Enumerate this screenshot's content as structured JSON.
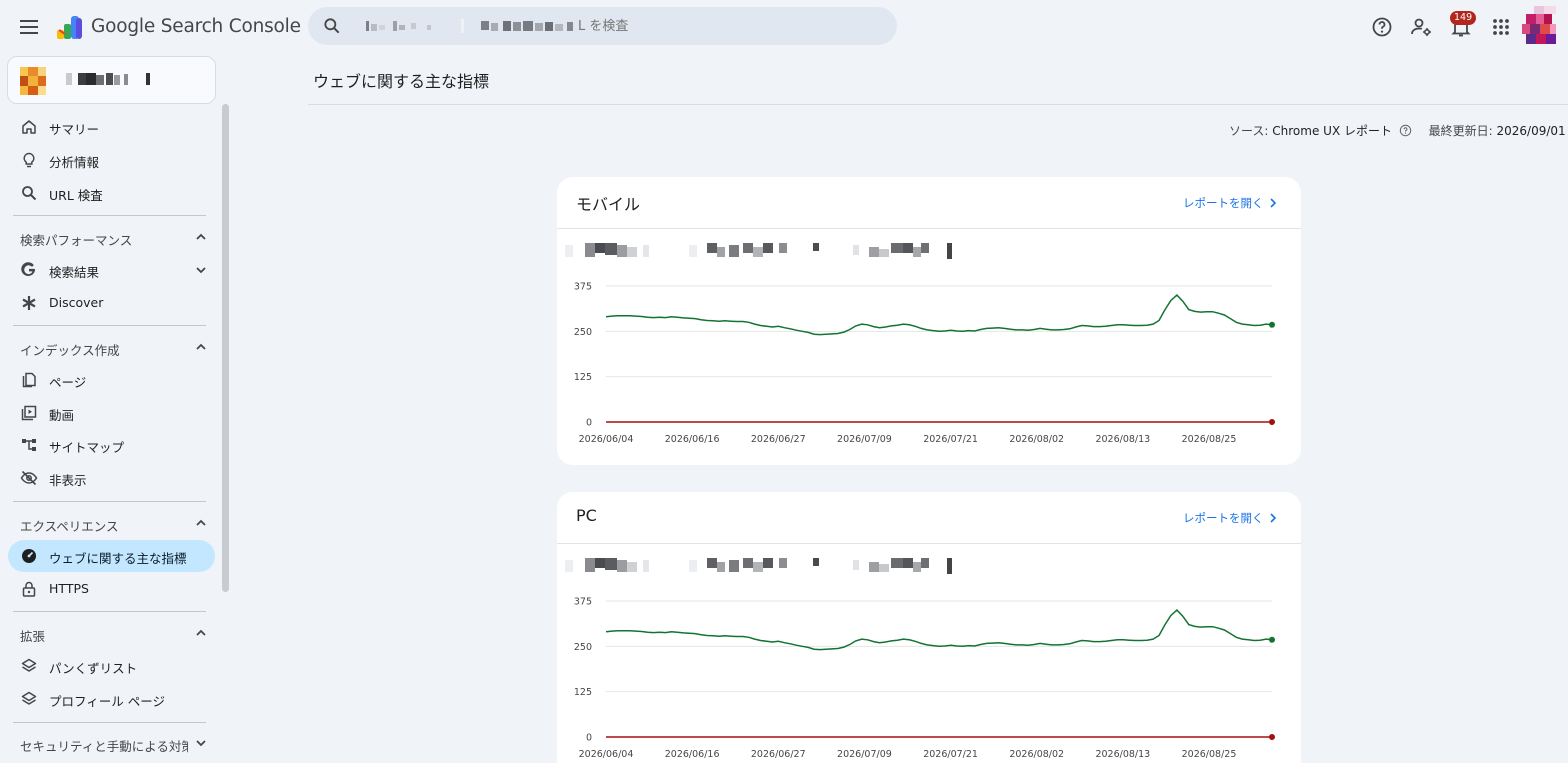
{
  "app": {
    "product_name": "Google Search Console",
    "search_placeholder": "L を検査",
    "notification_count": "149"
  },
  "colors": {
    "good_line": "#137333",
    "poor_line": "#a50e0e",
    "accent_link": "#1a73e8",
    "active_nav_bg": "#c2e7ff",
    "badge": "#b3261e"
  },
  "sidebar": {
    "top_items": [
      {
        "label": "サマリー",
        "icon": "home-icon"
      },
      {
        "label": "分析情報",
        "icon": "lightbulb-icon"
      },
      {
        "label": "URL 検査",
        "icon": "search-icon"
      }
    ],
    "sections": [
      {
        "label": "検索パフォーマンス",
        "expanded": true,
        "items": [
          {
            "label": "検索結果",
            "icon": "google-g-icon",
            "has_submenu": true
          },
          {
            "label": "Discover",
            "icon": "asterisk-icon"
          }
        ]
      },
      {
        "label": "インデックス作成",
        "expanded": true,
        "items": [
          {
            "label": "ページ",
            "icon": "pages-icon"
          },
          {
            "label": "動画",
            "icon": "video-icon"
          },
          {
            "label": "サイトマップ",
            "icon": "sitemap-icon"
          },
          {
            "label": "非表示",
            "icon": "eye-off-icon"
          }
        ]
      },
      {
        "label": "エクスペリエンス",
        "expanded": true,
        "items": [
          {
            "label": "ウェブに関する主な指標",
            "icon": "speedometer-icon",
            "active": true
          },
          {
            "label": "HTTPS",
            "icon": "lock-icon"
          }
        ]
      },
      {
        "label": "拡張",
        "expanded": true,
        "items": [
          {
            "label": "パンくずリスト",
            "icon": "layers-icon"
          },
          {
            "label": "プロフィール ページ",
            "icon": "layers-icon"
          }
        ]
      },
      {
        "label": "セキュリティと手動による対策",
        "expanded": false,
        "items": []
      }
    ]
  },
  "main": {
    "page_title": "ウェブに関する主な指標",
    "source_label": "ソース:",
    "source_value": "Chrome UX レポート",
    "updated_label": "最終更新日:",
    "updated_value": "2026/09/01",
    "cards": [
      {
        "title": "モバイル",
        "link": "レポートを開く"
      },
      {
        "title": "PC",
        "link": "レポートを開く"
      }
    ]
  },
  "chart_data": [
    {
      "type": "line",
      "title": "モバイル",
      "xlabel": "",
      "ylabel": "",
      "ylim": [
        0,
        375
      ],
      "yticks": [
        0,
        125,
        250,
        375
      ],
      "xtick_labels": [
        "2026/06/04",
        "2026/06/16",
        "2026/06/27",
        "2026/07/09",
        "2026/07/21",
        "2026/08/02",
        "2026/08/13",
        "2026/08/25"
      ],
      "grid": true,
      "series": [
        {
          "color": "#137333",
          "values": [
            290,
            292,
            293,
            293,
            293,
            292,
            291,
            289,
            288,
            289,
            288,
            290,
            289,
            287,
            286,
            285,
            282,
            280,
            279,
            278,
            279,
            278,
            277,
            277,
            275,
            270,
            266,
            264,
            262,
            264,
            260,
            257,
            253,
            250,
            247,
            242,
            241,
            242,
            243,
            244,
            248,
            255,
            265,
            270,
            268,
            263,
            260,
            262,
            265,
            267,
            270,
            268,
            264,
            258,
            254,
            252,
            250,
            251,
            253,
            251,
            250,
            252,
            251,
            255,
            258,
            259,
            260,
            258,
            256,
            254,
            254,
            253,
            255,
            258,
            256,
            254,
            254,
            255,
            257,
            262,
            266,
            265,
            263,
            263,
            264,
            266,
            268,
            268,
            267,
            266,
            266,
            267,
            270,
            280,
            310,
            335,
            350,
            333,
            310,
            305,
            303,
            304,
            304,
            300,
            295,
            285,
            275,
            270,
            268,
            266,
            267,
            270,
            268
          ]
        },
        {
          "color": "#a50e0e",
          "values": [
            0,
            0,
            0,
            0,
            0,
            0,
            0,
            0,
            0,
            0,
            0,
            0,
            0,
            0,
            0,
            0,
            0,
            0,
            0,
            0,
            0,
            0,
            0,
            0,
            0,
            0,
            0,
            0,
            0,
            0,
            0,
            0,
            0,
            0,
            0,
            0,
            0,
            0,
            0,
            0,
            0,
            0,
            0,
            0,
            0,
            0,
            0,
            0,
            0,
            0,
            0,
            0,
            0,
            0,
            0,
            0,
            0,
            0,
            0,
            0,
            0,
            0,
            0,
            0,
            0,
            0,
            0,
            0,
            0,
            0,
            0,
            0,
            0,
            0,
            0,
            0,
            0,
            0,
            0,
            0,
            0,
            0,
            0,
            0,
            0,
            0,
            0,
            0,
            0,
            0,
            0,
            0,
            0,
            0,
            0,
            0,
            0,
            0,
            0,
            0,
            0,
            0,
            0,
            0,
            0,
            0,
            0,
            0,
            0,
            0,
            0,
            0,
            0
          ]
        }
      ]
    },
    {
      "type": "line",
      "title": "PC",
      "xlabel": "",
      "ylabel": "",
      "ylim": [
        0,
        375
      ],
      "yticks": [
        0,
        125,
        250,
        375
      ],
      "xtick_labels": [
        "2026/06/04",
        "2026/06/16",
        "2026/06/27",
        "2026/07/09",
        "2026/07/21",
        "2026/08/02",
        "2026/08/13",
        "2026/08/25"
      ],
      "grid": true,
      "series": [
        {
          "color": "#137333",
          "values": [
            290,
            292,
            293,
            293,
            293,
            292,
            291,
            289,
            288,
            289,
            288,
            290,
            289,
            287,
            286,
            285,
            282,
            280,
            279,
            278,
            279,
            278,
            277,
            277,
            275,
            270,
            266,
            264,
            262,
            264,
            260,
            257,
            253,
            250,
            247,
            242,
            241,
            242,
            243,
            244,
            248,
            255,
            265,
            270,
            268,
            263,
            260,
            262,
            265,
            267,
            270,
            268,
            264,
            258,
            254,
            252,
            250,
            251,
            253,
            251,
            250,
            252,
            251,
            255,
            258,
            259,
            260,
            258,
            256,
            254,
            254,
            253,
            255,
            258,
            256,
            254,
            254,
            255,
            257,
            262,
            266,
            265,
            263,
            263,
            264,
            266,
            268,
            268,
            267,
            266,
            266,
            267,
            270,
            280,
            310,
            335,
            350,
            333,
            310,
            305,
            303,
            304,
            304,
            300,
            295,
            285,
            275,
            270,
            268,
            266,
            267,
            270,
            268
          ]
        },
        {
          "color": "#a50e0e",
          "values": [
            0,
            0,
            0,
            0,
            0,
            0,
            0,
            0,
            0,
            0,
            0,
            0,
            0,
            0,
            0,
            0,
            0,
            0,
            0,
            0,
            0,
            0,
            0,
            0,
            0,
            0,
            0,
            0,
            0,
            0,
            0,
            0,
            0,
            0,
            0,
            0,
            0,
            0,
            0,
            0,
            0,
            0,
            0,
            0,
            0,
            0,
            0,
            0,
            0,
            0,
            0,
            0,
            0,
            0,
            0,
            0,
            0,
            0,
            0,
            0,
            0,
            0,
            0,
            0,
            0,
            0,
            0,
            0,
            0,
            0,
            0,
            0,
            0,
            0,
            0,
            0,
            0,
            0,
            0,
            0,
            0,
            0,
            0,
            0,
            0,
            0,
            0,
            0,
            0,
            0,
            0,
            0,
            0,
            0,
            0,
            0,
            0,
            0,
            0,
            0,
            0,
            0,
            0,
            0,
            0,
            0,
            0,
            0,
            0,
            0,
            0,
            0,
            0
          ]
        }
      ]
    }
  ]
}
